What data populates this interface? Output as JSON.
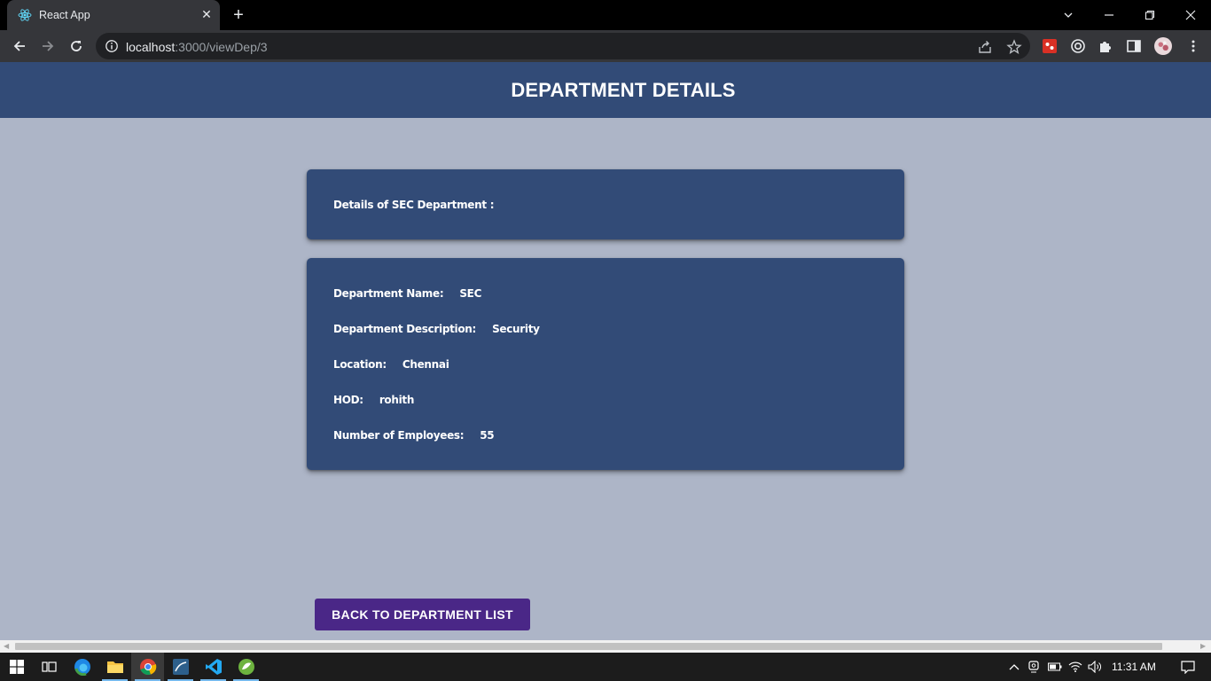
{
  "browser": {
    "tab_title": "React App",
    "url_host": "localhost",
    "url_path": ":3000/viewDep/3"
  },
  "page": {
    "header_title": "DEPARTMENT DETAILS",
    "summary_heading": "Details of SEC Department :",
    "details": [
      {
        "label": "Department Name:",
        "value": "SEC"
      },
      {
        "label": "Department Description:",
        "value": "Security"
      },
      {
        "label": "Location:",
        "value": "Chennai"
      },
      {
        "label": "HOD:",
        "value": "rohith"
      },
      {
        "label": "Number of Employees:",
        "value": "55"
      }
    ],
    "back_button": "BACK TO DEPARTMENT LIST"
  },
  "taskbar": {
    "clock": "11:31 AM"
  },
  "colors": {
    "header_bg": "#324b77",
    "page_bg": "#adb5c7",
    "button_bg": "#4a2787"
  }
}
